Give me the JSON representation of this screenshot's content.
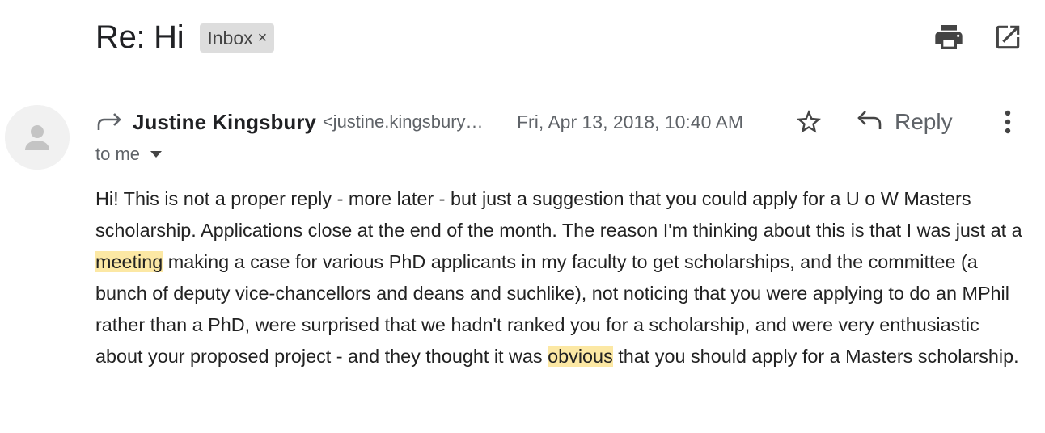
{
  "email": {
    "subject": "Re: Hi",
    "label": "Inbox",
    "label_close": "×",
    "sender_name": "Justine Kingsbury",
    "sender_email": "<justine.kingsbury…",
    "date": "Fri, Apr 13, 2018, 10:40 AM",
    "reply_label": "Reply",
    "recipient": "to me",
    "body": {
      "part1": "Hi! This is not a proper reply - more later - but just a suggestion that you could apply for a U o W Masters scholarship. Applications close at the end of the month. The reason I'm thinking about this is that I was just at a ",
      "highlight1": "meeting",
      "part2": " making a case for various PhD applicants in my faculty to get scholarships, and the committee (a bunch of deputy vice-chancellors and deans and suchlike), not noticing that you were applying to do an MPhil rather than a PhD, were surprised that we hadn't ranked you for a scholarship, and were very enthusiastic about your proposed project - and they thought it was ",
      "highlight2": "obvious",
      "part3": " that you should apply for a Masters scholarship."
    }
  },
  "icons": {
    "print": "print-icon",
    "open_new_window": "open-in-new-window-icon",
    "avatar": "default-avatar-icon",
    "forwarded": "forward-arrow-icon",
    "star": "star-outline-icon",
    "reply": "reply-arrow-icon",
    "more": "more-vertical-icon",
    "caret": "caret-down-icon"
  },
  "colors": {
    "highlight": "#fce8a4",
    "label_chip": "#dddddd",
    "icon": "#5f6368",
    "text": "#222222"
  }
}
